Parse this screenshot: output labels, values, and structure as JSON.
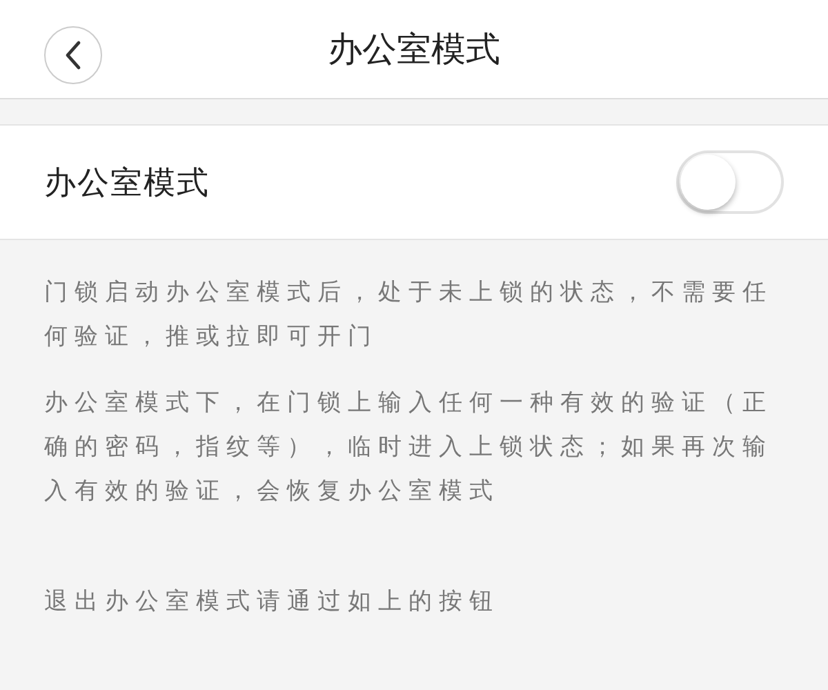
{
  "header": {
    "title": "办公室模式"
  },
  "setting": {
    "label": "办公室模式",
    "on": false
  },
  "notes": [
    "门锁启动办公室模式后，处于未上锁的状态，不需要任何验证，推或拉即可开门",
    "办公室模式下，在门锁上输入任何一种有效的验证（正确的密码，指纹等），临时进入上锁状态；如果再次输入有效的验证，会恢复办公室模式",
    "退出办公室模式请通过如上的按钮"
  ]
}
